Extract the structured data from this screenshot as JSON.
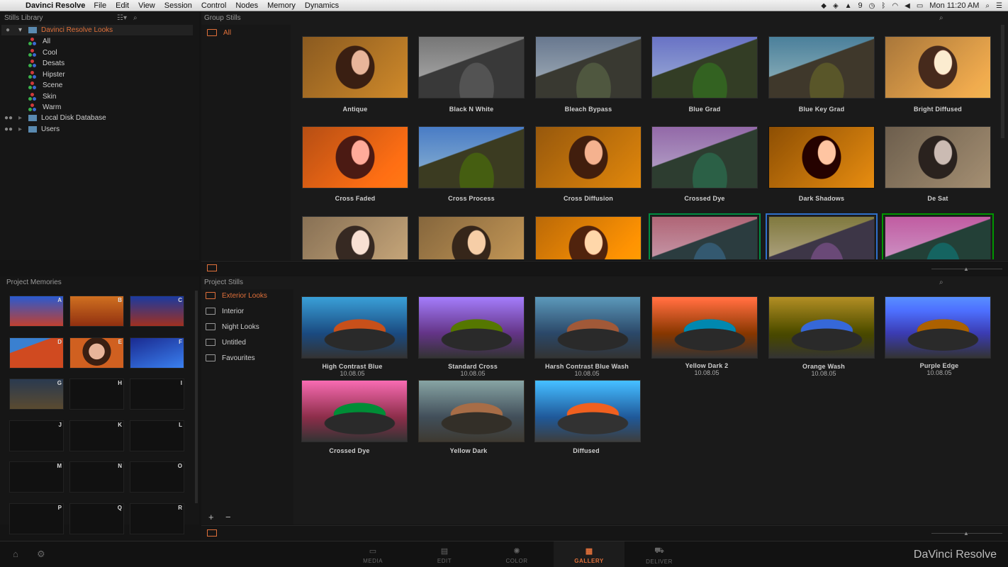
{
  "menubar": {
    "apple_icon": "apple-icon",
    "app_name": "Davinci Resolve",
    "menus": [
      "File",
      "Edit",
      "View",
      "Session",
      "Control",
      "Nodes",
      "Memory",
      "Dynamics"
    ],
    "status_badge": "9",
    "clock": "Mon 11:20 AM"
  },
  "stills_library": {
    "title": "Stills Library",
    "tree": [
      {
        "label": "Davinci Resolve Looks",
        "selected": true
      },
      {
        "label": "All"
      },
      {
        "label": "Cool"
      },
      {
        "label": "Desats"
      },
      {
        "label": "Hipster"
      },
      {
        "label": "Scene"
      },
      {
        "label": "Skin"
      },
      {
        "label": "Warm"
      },
      {
        "label": "Local Disk Database"
      },
      {
        "label": "Users"
      }
    ]
  },
  "group_stills": {
    "title": "Group Stills",
    "folder": "All",
    "stills": [
      {
        "label": "Antique",
        "kind": "face"
      },
      {
        "label": "Black N White",
        "kind": "mtn"
      },
      {
        "label": "Bleach Bypass",
        "kind": "mtn"
      },
      {
        "label": "Blue Grad",
        "kind": "mtn"
      },
      {
        "label": "Blue Key Grad",
        "kind": "mtn"
      },
      {
        "label": "Bright Diffused",
        "kind": "face"
      },
      {
        "label": "Cross Faded",
        "kind": "face"
      },
      {
        "label": "Cross Process",
        "kind": "mtn"
      },
      {
        "label": "Cross Diffusion",
        "kind": "face"
      },
      {
        "label": "Crossed Dye",
        "kind": "mtn"
      },
      {
        "label": "Dark Shadows",
        "kind": "face"
      },
      {
        "label": "De Sat",
        "kind": "face"
      }
    ]
  },
  "project_memories": {
    "title": "Project Memories",
    "slots": [
      "A",
      "B",
      "C",
      "D",
      "E",
      "F",
      "G",
      "H",
      "I",
      "J",
      "K",
      "L",
      "M",
      "N",
      "O",
      "P",
      "Q",
      "R"
    ]
  },
  "project_stills": {
    "title": "Project Stills",
    "folders": [
      "Exterior Looks",
      "Interior",
      "Night Looks",
      "Untitled",
      "Favourites"
    ],
    "add_label": "+",
    "remove_label": "−",
    "stills": [
      {
        "label": "High Contrast Blue",
        "date": "10.08.05"
      },
      {
        "label": "Standard Cross",
        "date": "10.08.05"
      },
      {
        "label": "Harsh Contrast Blue Wash",
        "date": "10.08.05"
      },
      {
        "label": "Yellow Dark 2",
        "date": "10.08.05"
      },
      {
        "label": "Orange Wash",
        "date": "10.08.05"
      },
      {
        "label": "Purple Edge",
        "date": "10.08.05"
      },
      {
        "label": "Crossed Dye",
        "date": ""
      },
      {
        "label": "Yellow Dark",
        "date": ""
      },
      {
        "label": "Diffused",
        "date": ""
      }
    ]
  },
  "bottombar": {
    "tabs": [
      "MEDIA",
      "EDIT",
      "COLOR",
      "GALLERY",
      "DELIVER"
    ],
    "active_tab": "GALLERY",
    "brand": "DaVinci Resolve"
  },
  "colors": {
    "accent": "#e0703a",
    "bg": "#141414",
    "panel": "#1a1a1a"
  }
}
